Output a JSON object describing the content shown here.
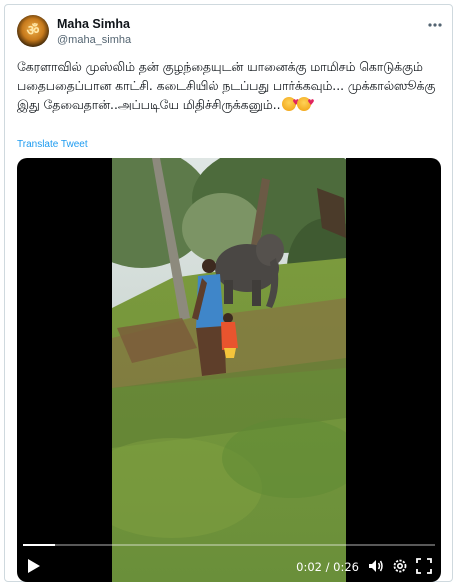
{
  "author": {
    "display_name": "Maha Simha",
    "handle": "@maha_simha"
  },
  "tweet": {
    "text": "கேரளாவில் முஸ்லிம் தன் குழந்தையுடன் யானைக்கு மாமிசம் கொடுக்கும் பதைபதைப்பான காட்சி. கடைசியில் நடப்பது பார்க்கவும்... முக்கால்ஸூக்கு இது தேவைதான்..அப்படியே மிதிச்சிருக்கனும்..",
    "translate_label": "Translate Tweet"
  },
  "video": {
    "time_display": "0:02 / 0:26",
    "progress": 0.077
  },
  "icons": {
    "more": "more-horizontal-icon",
    "play": "play-icon",
    "volume": "volume-icon",
    "settings": "gear-icon",
    "fullscreen": "fullscreen-icon"
  },
  "colors": {
    "link": "#1d9bf0",
    "secondary_text": "#536471",
    "border": "#cfd9de"
  }
}
